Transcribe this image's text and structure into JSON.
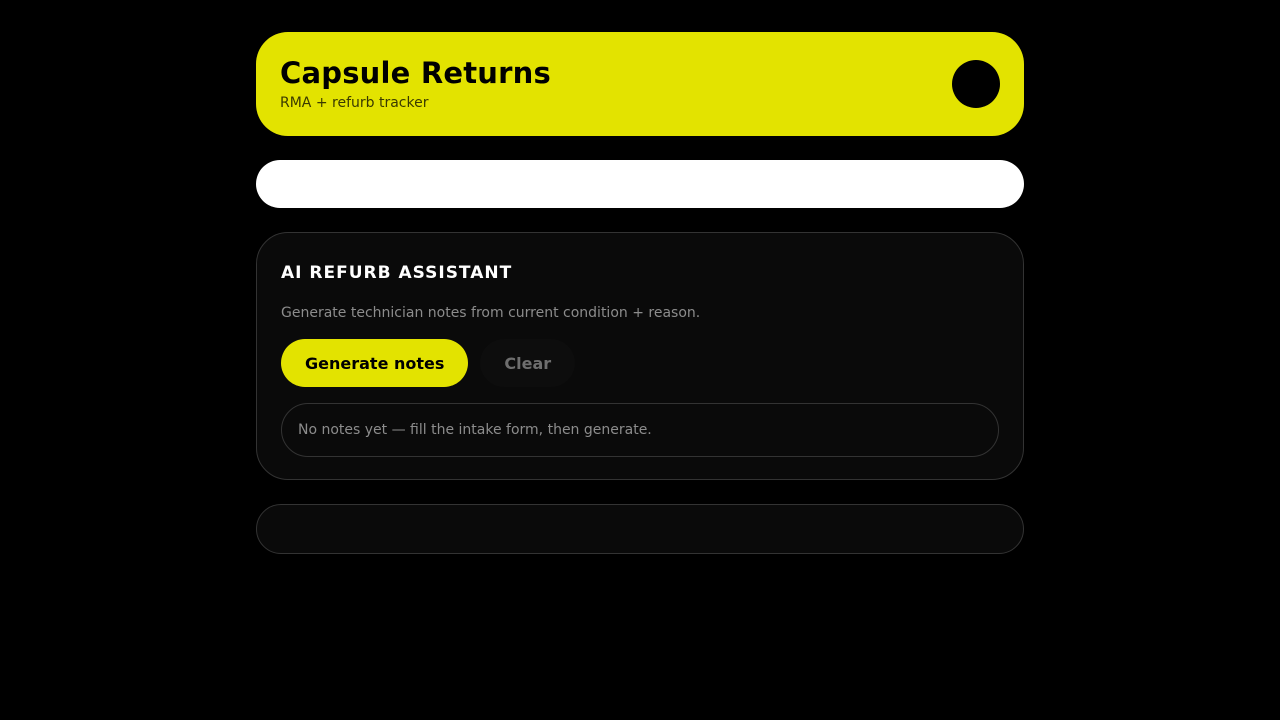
{
  "header": {
    "title": "Capsule Returns",
    "subtitle": "RMA + refurb tracker"
  },
  "assistant": {
    "title": "AI REFURB ASSISTANT",
    "description": "Generate technician notes from current condition + reason.",
    "generate_label": "Generate notes",
    "clear_label": "Clear",
    "notes_placeholder": "No notes yet — fill the intake form, then generate."
  },
  "colors": {
    "accent": "#e3e300",
    "background": "#000000",
    "card": "#0a0a0a"
  }
}
